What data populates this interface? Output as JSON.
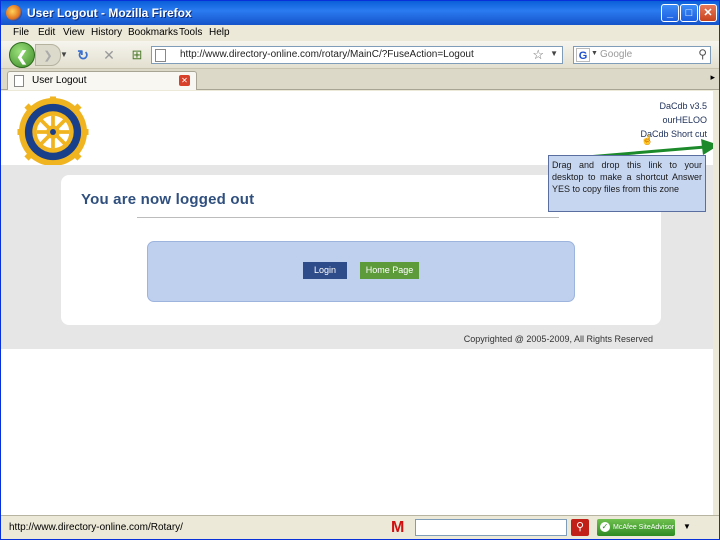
{
  "window": {
    "title": "User Logout - Mozilla Firefox"
  },
  "menu": [
    "File",
    "Edit",
    "View",
    "History",
    "Bookmarks",
    "Tools",
    "Help"
  ],
  "nav": {
    "url": "http://www.directory-online.com/rotary/MainC/?FuseAction=Logout",
    "search_placeholder": "Google"
  },
  "tab": {
    "label": "User Logout"
  },
  "header": {
    "links": [
      "DaCdb v3.5",
      "ourHELOO",
      "DaCdb Short cut"
    ]
  },
  "tooltip": {
    "text": "Drag and drop this link to your desktop to make a shortcut Answer YES to copy files from this zone"
  },
  "main": {
    "title": "You are now logged out",
    "login_label": "Login",
    "home_label": "Home Page",
    "copyright": "Copyrighted @ 2005-2009, All Rights Reserved"
  },
  "status": {
    "text": "http://www.directory-online.com/Rotary/",
    "siteadvisor_label": "McAfee SiteAdvisor"
  },
  "colors": {
    "title_text": "#2f4f7f",
    "panel": "#bed0ee",
    "login_button": "#2f4c8a",
    "home_button": "#5c9a3a",
    "arrow": "#1c8a2a"
  }
}
